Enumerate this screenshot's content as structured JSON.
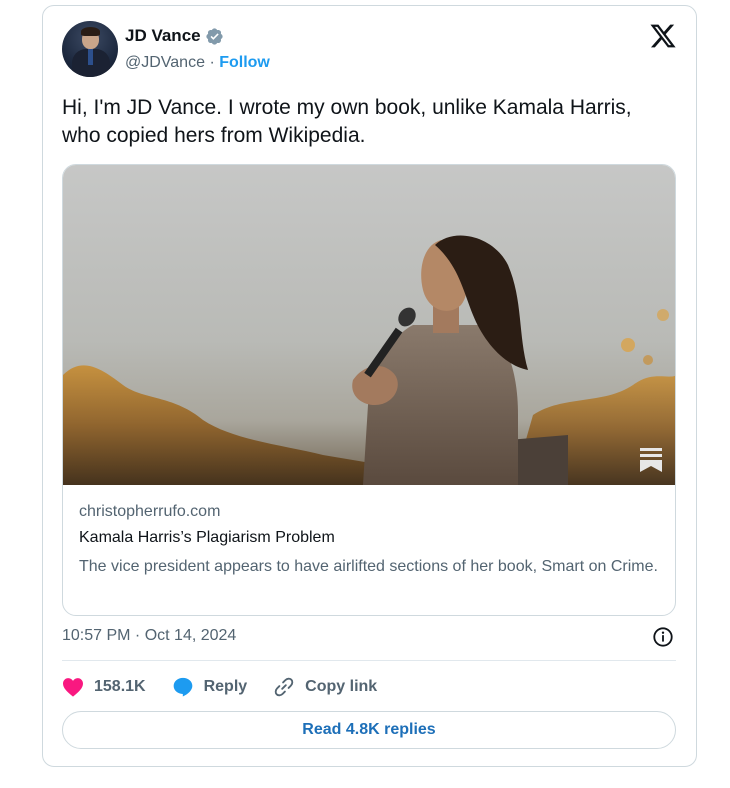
{
  "author": {
    "name": "JD Vance",
    "handle": "@JDVance",
    "separator": "·",
    "follow_label": "Follow",
    "verified_icon": "verified-badge-icon",
    "verified_color": "#829aab"
  },
  "platform_icon": "x-logo-icon",
  "tweet": {
    "text": "Hi, I'm JD Vance. I wrote my own book, unlike Kamala Harris, who copied hers from Wikipedia."
  },
  "link_preview": {
    "domain": "christopherrufo.com",
    "title": "Kamala Harris’s Plagiarism Problem",
    "description": "The vice president appears to have airlifted sections of her book, Smart on Crime.",
    "image_icon": "bookmark-icon"
  },
  "timestamp": "10:57 PM · Oct 14, 2024",
  "actions": {
    "like_count": "158.1K",
    "reply_label": "Reply",
    "copy_link_label": "Copy link"
  },
  "read_replies_label": "Read 4.8K replies",
  "colors": {
    "like": "#f91880",
    "reply": "#1d9bf0",
    "link": "#1d9bf0",
    "muted": "#536471"
  }
}
